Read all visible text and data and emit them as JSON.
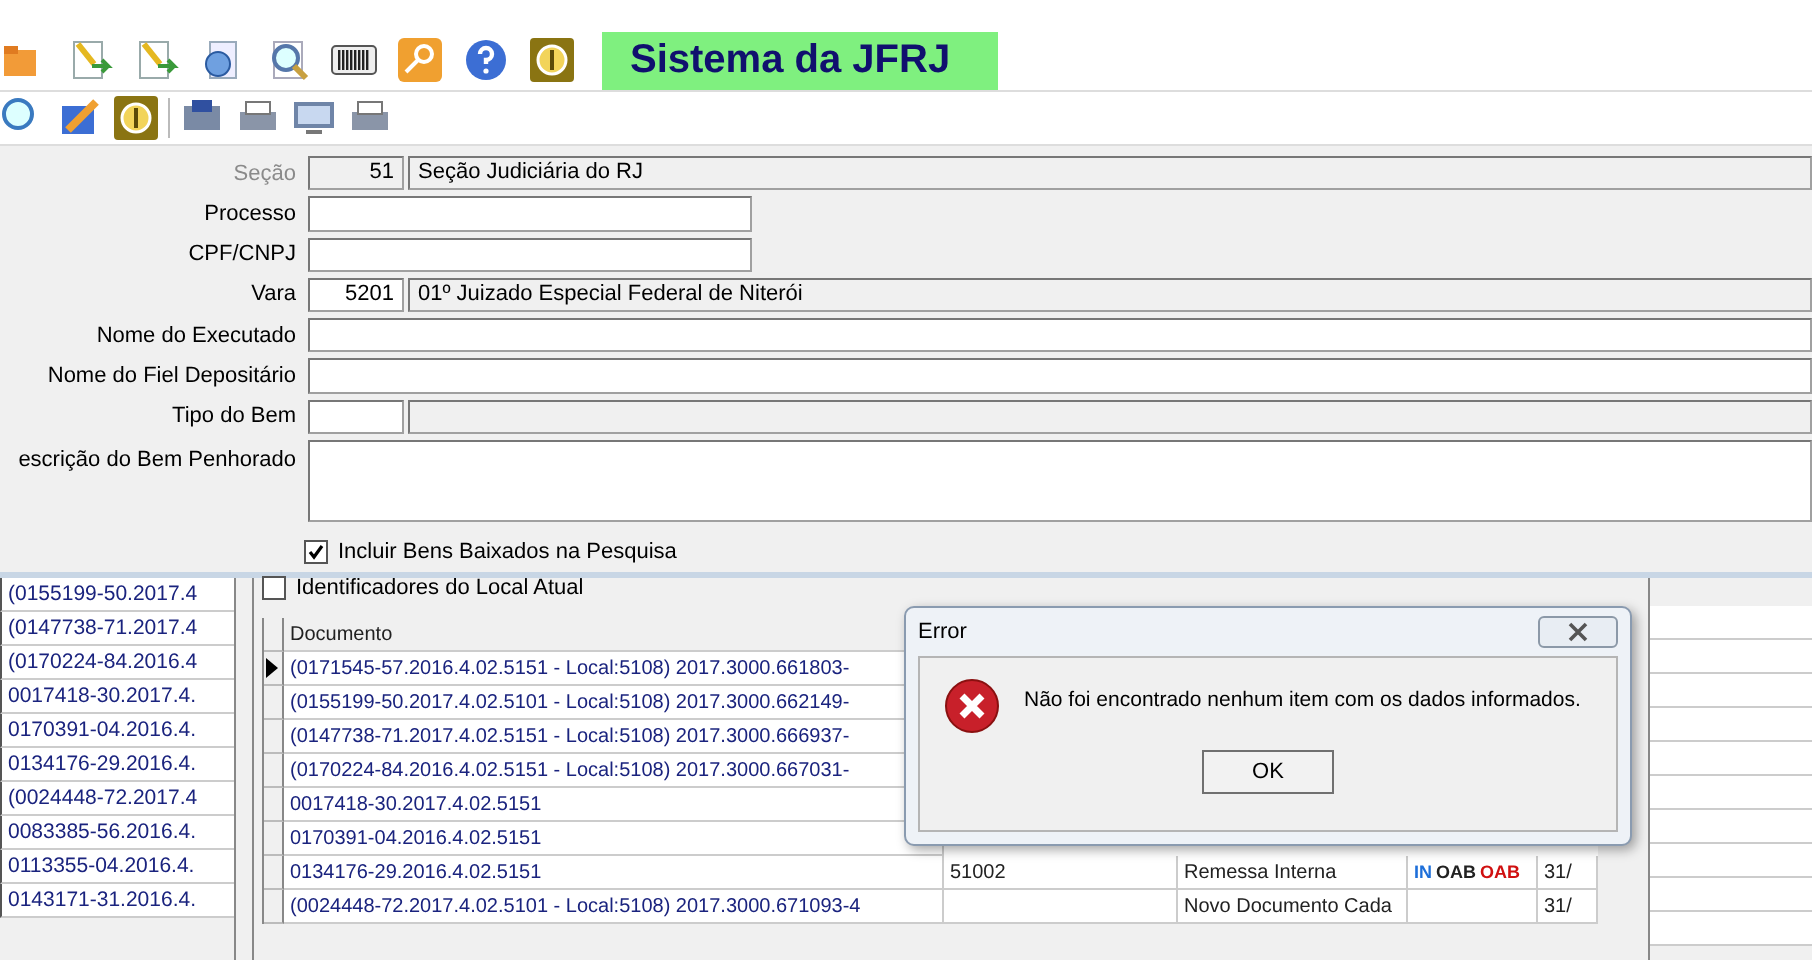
{
  "app_title": "Sistema da JFRJ",
  "form": {
    "fields": [
      {
        "label": "Seção",
        "kind": "code_name",
        "code": "51",
        "name": "Seção Judiciária do RJ",
        "disabled": true
      },
      {
        "label": "Processo",
        "kind": "short",
        "disabled": false
      },
      {
        "label": "CPF/CNPJ",
        "kind": "short",
        "disabled": false
      },
      {
        "label": "Vara",
        "kind": "code_name",
        "code": "5201",
        "name": "01º Juizado Especial Federal de Niterói",
        "disabled": false
      },
      {
        "label": "Nome do Executado",
        "kind": "wide",
        "disabled": false
      },
      {
        "label": "Nome do Fiel Depositário",
        "kind": "wide",
        "disabled": false
      },
      {
        "label": "Tipo do Bem",
        "kind": "code_name",
        "disabled": false
      },
      {
        "label": "escrição do Bem Penhorado",
        "kind": "area",
        "disabled": false
      }
    ],
    "checkbox": {
      "label": "Incluir Bens Baixados na Pesquisa",
      "checked": true
    }
  },
  "left_list": [
    "(0155199-50.2017.4",
    "(0147738-71.2017.4",
    "(0170224-84.2016.4",
    "0017418-30.2017.4.",
    "0170391-04.2016.4.",
    "0134176-29.2016.4.",
    "(0024448-72.2017.4",
    "0083385-56.2016.4.",
    "0113355-04.2016.4.",
    "0143171-31.2016.4."
  ],
  "table": {
    "checkbox": {
      "label": "Identificadores do Local Atual",
      "checked": false
    },
    "columns": [
      "Documento"
    ],
    "rows": [
      {
        "selected": true,
        "documento": "(0171545-57.2016.4.02.5151 - Local:5108) 2017.3000.661803-"
      },
      {
        "selected": false,
        "documento": "(0155199-50.2017.4.02.5101 - Local:5108) 2017.3000.662149-"
      },
      {
        "selected": false,
        "documento": "(0147738-71.2017.4.02.5151 - Local:5108) 2017.3000.666937-"
      },
      {
        "selected": false,
        "documento": "(0170224-84.2016.4.02.5151 - Local:5108) 2017.3000.667031-"
      },
      {
        "selected": false,
        "documento": "0017418-30.2017.4.02.5151"
      },
      {
        "selected": false,
        "documento": "0170391-04.2016.4.02.5151"
      },
      {
        "selected": false,
        "documento": "0134176-29.2016.4.02.5151",
        "column_2": "51002",
        "column_3": "Remessa Interna",
        "badges": [
          {
            "text": "IN",
            "color": "#1e6fd9"
          },
          {
            "text": "OAB",
            "color": "#222222"
          },
          {
            "text": "OAB",
            "color": "#d01010"
          }
        ],
        "column_5": "31/"
      },
      {
        "selected": false,
        "documento": "(0024448-72.2017.4.02.5101 - Local:5108) 2017.3000.671093-4",
        "column_3": "Novo Documento Cada",
        "column_5": "31/"
      }
    ]
  },
  "dialog": {
    "title": "Error",
    "message": "Não foi encontrado nenhum item com os dados informados.",
    "button": "OK"
  }
}
